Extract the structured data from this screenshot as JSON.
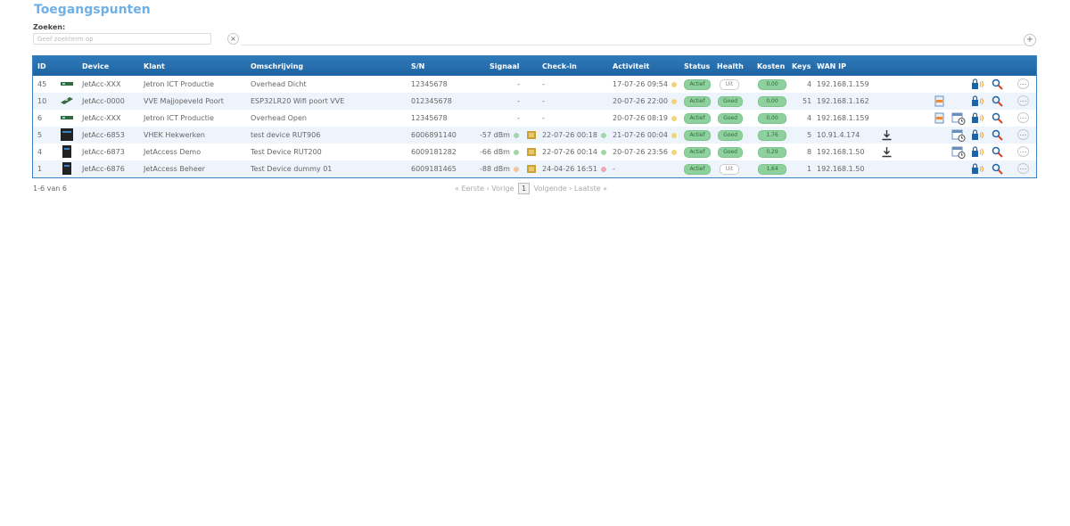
{
  "page": {
    "title": "Toegangspunten"
  },
  "search": {
    "label": "Zoeken:",
    "placeholder": "Geef zoekterm op",
    "clear": "×",
    "add": "+"
  },
  "table": {
    "headers": {
      "id": "ID",
      "device": "Device",
      "klant": "Klant",
      "omschrijving": "Omschrijving",
      "sn": "S/N",
      "signaal": "Signaal",
      "checkin": "Check-in",
      "activiteit": "Activiteit",
      "status": "Status",
      "health": "Health",
      "kosten": "Kosten",
      "keys": "Keys",
      "wanip": "WAN IP"
    },
    "rows": [
      {
        "id": "45",
        "device": "JetAcc-XXX",
        "klant": "Jetron ICT Productie",
        "omschrijving": "Overhead Dicht",
        "sn": "12345678",
        "signaal": "-",
        "checkin": "-",
        "activiteit": "17-07-26 09:54",
        "status": "Actief",
        "health": "Uit",
        "kosten": "0,00",
        "keys": "4",
        "wanip": "192.168.1.159"
      },
      {
        "id": "10",
        "device": "JetAcc-0000",
        "klant": "VVE Majjopeveld Poort",
        "omschrijving": "ESP32LR20 Wifi poort VVE",
        "sn": "012345678",
        "signaal": "-",
        "checkin": "-",
        "activiteit": "20-07-26 22:00",
        "status": "Actief",
        "health": "Goed",
        "kosten": "0,00",
        "keys": "51",
        "wanip": "192.168.1.162"
      },
      {
        "id": "6",
        "device": "JetAcc-XXX",
        "klant": "Jetron ICT Productie",
        "omschrijving": "Overhead Open",
        "sn": "12345678",
        "signaal": "-",
        "checkin": "-",
        "activiteit": "20-07-26 08:19",
        "status": "Actief",
        "health": "Goed",
        "kosten": "0,00",
        "keys": "4",
        "wanip": "192.168.1.159"
      },
      {
        "id": "5",
        "device": "JetAcc-6853",
        "klant": "VHEK Hekwerken",
        "omschrijving": "test device RUT906",
        "sn": "6006891140",
        "signaal": "-57 dBm",
        "checkin": "22-07-26 00:18",
        "activiteit": "21-07-26 00:04",
        "status": "Actief",
        "health": "Goed",
        "kosten": "1,76",
        "keys": "5",
        "wanip": "10.91.4.174"
      },
      {
        "id": "4",
        "device": "JetAcc-6873",
        "klant": "JetAccess Demo",
        "omschrijving": "Test Device RUT200",
        "sn": "6009181282",
        "signaal": "-66 dBm",
        "checkin": "22-07-26 00:14",
        "activiteit": "20-07-26 23:56",
        "status": "Actief",
        "health": "Goed",
        "kosten": "0,29",
        "keys": "8",
        "wanip": "192.168.1.50"
      },
      {
        "id": "1",
        "device": "JetAcc-6876",
        "klant": "JetAccess Beheer",
        "omschrijving": "Test Device dummy 01",
        "sn": "6009181465",
        "signaal": "-88 dBm",
        "checkin": "24-04-26 16:51",
        "activiteit": "-",
        "status": "Actief",
        "health": "Uit",
        "kosten": "1,64",
        "keys": "1",
        "wanip": "192.168.1.50"
      }
    ]
  },
  "footer": {
    "count": "1-6 van 6",
    "first": "« Eerste",
    "prev": "‹ Vorige",
    "page": "1",
    "next": "Volgende ›",
    "last": "Laatste »"
  },
  "colors": {
    "header": "#2f7ab9",
    "title": "#6fb0e6",
    "pill_green": "#8fd19e",
    "dot_green": "#9fd7a6",
    "dot_yellow": "#f3d27a",
    "dot_pink": "#f2a6b3"
  }
}
